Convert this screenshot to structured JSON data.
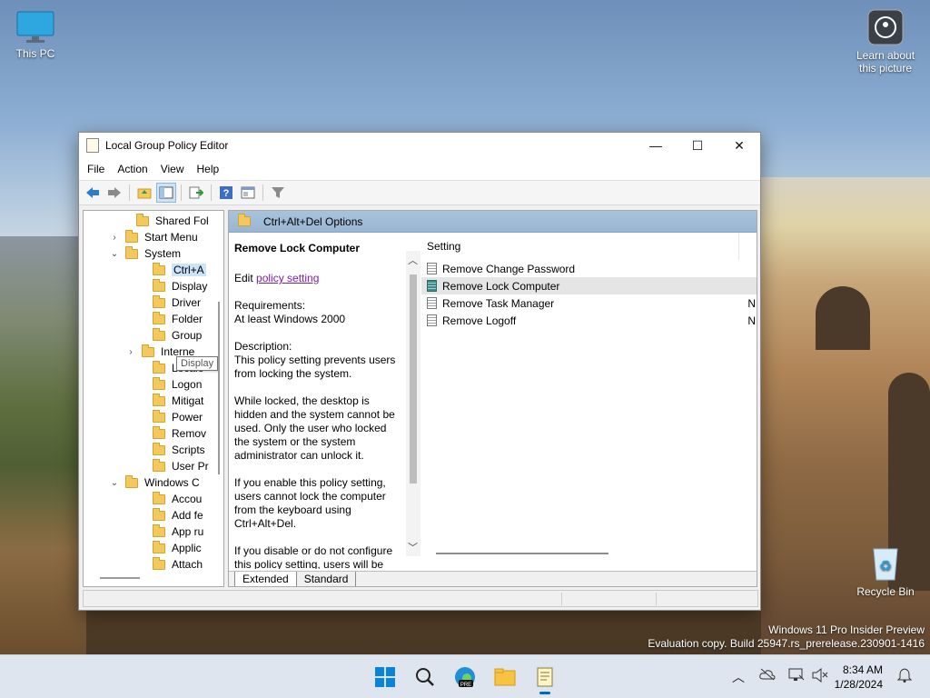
{
  "desktop": {
    "icons": {
      "this_pc": "This PC",
      "learn": "Learn about this picture",
      "recycle_bin": "Recycle Bin"
    },
    "watermark": {
      "line1": "Windows 11 Pro Insider Preview",
      "line2": "Evaluation copy. Build 25947.rs_prerelease.230901-1416"
    }
  },
  "window": {
    "title": "Local Group Policy Editor",
    "controls": {
      "minimize": "—",
      "maximize": "☐",
      "close": "✕"
    },
    "menu": [
      "File",
      "Action",
      "View",
      "Help"
    ],
    "toolbar_icons": [
      "back-arrow-icon",
      "forward-arrow-icon",
      "up-folder-icon",
      "show-hide-tree-icon",
      "export-list-icon",
      "help-icon",
      "properties-icon",
      "filter-icon"
    ]
  },
  "tree": {
    "items": [
      {
        "label": "Shared Fol",
        "chevron": ""
      },
      {
        "label": "Start Menu",
        "chevron": "›"
      },
      {
        "label": "System",
        "chevron": "⌄"
      },
      {
        "label": "Ctrl+A",
        "chevron": ""
      },
      {
        "label": "Display",
        "chevron": ""
      },
      {
        "label": "Driver",
        "chevron": ""
      },
      {
        "label": "Folder",
        "chevron": ""
      },
      {
        "label": "Group",
        "chevron": ""
      },
      {
        "label": "Interne",
        "chevron": "›"
      },
      {
        "label": "Locale",
        "chevron": ""
      },
      {
        "label": "Logon",
        "chevron": ""
      },
      {
        "label": "Mitigat",
        "chevron": ""
      },
      {
        "label": "Power",
        "chevron": ""
      },
      {
        "label": "Remov",
        "chevron": ""
      },
      {
        "label": "Scripts",
        "chevron": ""
      },
      {
        "label": "User Pr",
        "chevron": ""
      },
      {
        "label": "Windows C",
        "chevron": "⌄"
      },
      {
        "label": "Accou",
        "chevron": ""
      },
      {
        "label": "Add fe",
        "chevron": ""
      },
      {
        "label": "App ru",
        "chevron": ""
      },
      {
        "label": "Applic",
        "chevron": ""
      },
      {
        "label": "Attach",
        "chevron": ""
      }
    ],
    "tooltip": "Display"
  },
  "details": {
    "header": "Ctrl+Alt+Del Options",
    "heading": "Remove Lock Computer",
    "edit_prefix": "Edit ",
    "edit_link": "policy setting",
    "requirements_label": "Requirements:",
    "requirements_value": "At least Windows 2000",
    "description_label": "Description:",
    "description_p1": "This policy setting prevents users from locking the system.",
    "description_p2": "While locked, the desktop is hidden and the system cannot be used. Only the user who locked the system or the system administrator can unlock it.",
    "description_p3": "If you enable this policy setting, users cannot lock the computer from the keyboard using Ctrl+Alt+Del.",
    "description_p4": "If you disable or do not configure this policy setting, users will be"
  },
  "list": {
    "column_setting": "Setting",
    "rows": [
      {
        "name": "Remove Change Password",
        "state": ""
      },
      {
        "name": "Remove Lock Computer",
        "state": ""
      },
      {
        "name": "Remove Task Manager",
        "state": "N"
      },
      {
        "name": "Remove Logoff",
        "state": "N"
      }
    ]
  },
  "tabs": [
    "Extended",
    "Standard"
  ],
  "taskbar": {
    "apps": [
      "windows-start-icon",
      "search-icon",
      "edge-pre-icon",
      "file-explorer-icon",
      "group-policy-icon"
    ],
    "time": "8:34 AM",
    "date": "1/28/2024",
    "tray_icons": [
      "chevron-up-icon",
      "cloud-offline-icon",
      "network-icon",
      "volume-muted-icon",
      "notification-bell-icon"
    ]
  }
}
